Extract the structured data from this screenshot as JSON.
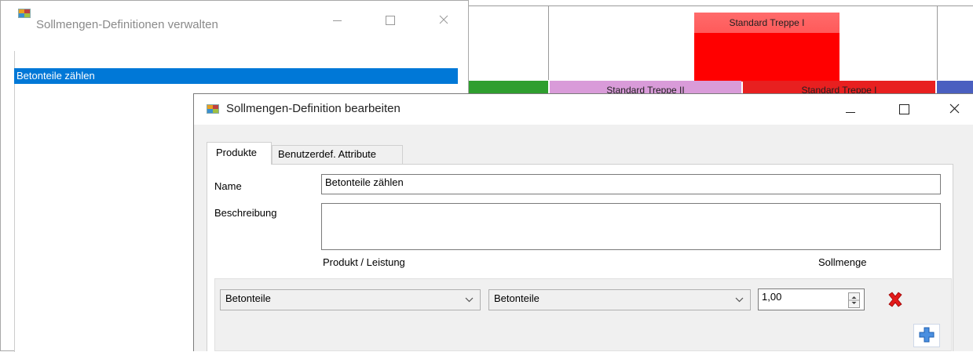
{
  "background": {
    "blocks": {
      "top_red_label": "Standard Treppe I",
      "purple_label": "Standard Treppe II",
      "red2_label": "Standard Treppe I"
    },
    "colors": {
      "red": "#ff0000",
      "purple": "#d99bd9",
      "green": "#2f9e2f",
      "blue": "#4a5fc0"
    }
  },
  "back_window": {
    "title": "Sollmengen-Definitionen verwalten",
    "list_items": [
      "Betonteile zählen"
    ]
  },
  "dialog": {
    "title": "Sollmengen-Definition bearbeiten",
    "tabs": [
      "Produkte",
      "Benutzerdef. Attribute"
    ],
    "name_label": "Name",
    "name_value": "Betonteile zählen",
    "description_label": "Beschreibung",
    "description_value": "",
    "col_product": "Produkt / Leistung",
    "col_quantity": "Sollmenge",
    "row": {
      "product": "Betonteile",
      "service": "Betonteile",
      "quantity": "1,00"
    }
  }
}
